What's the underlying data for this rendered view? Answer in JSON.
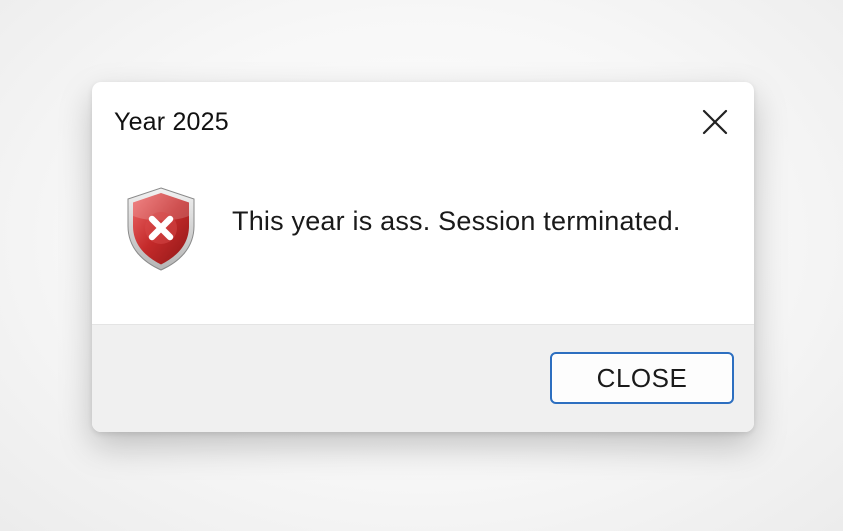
{
  "dialog": {
    "title": "Year 2025",
    "message": "This year is ass. Session terminated.",
    "icon": "error-shield-icon",
    "close_icon": "close-icon",
    "button_label": "CLOSE",
    "colors": {
      "button_border": "#2d6fc0",
      "shield_red": "#c42a2a",
      "footer_bg": "#f0f0f0"
    }
  }
}
